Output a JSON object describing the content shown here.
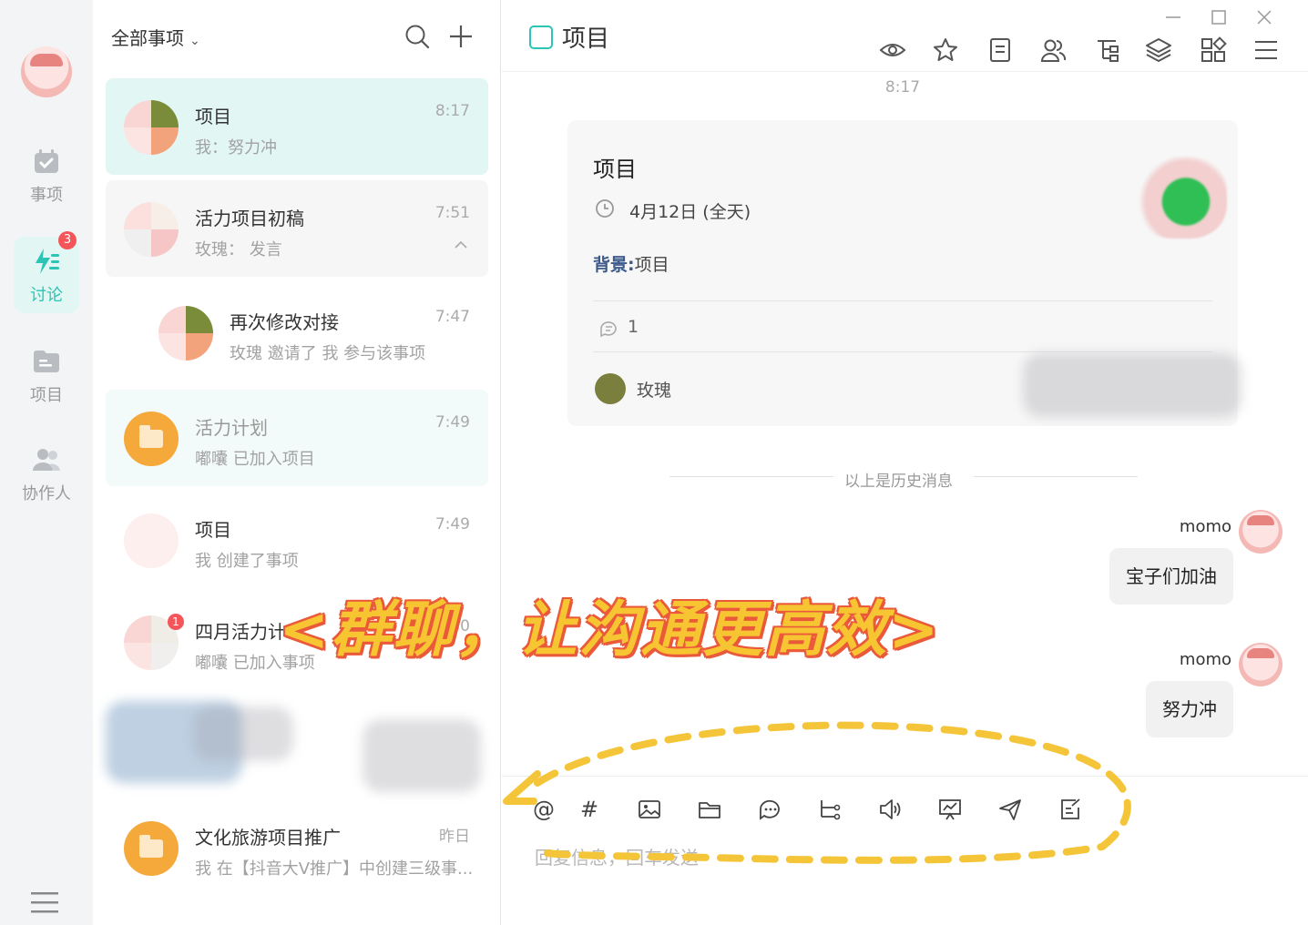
{
  "rail": {
    "nav": [
      {
        "label": "事项",
        "badge": ""
      },
      {
        "label": "讨论",
        "badge": "3"
      },
      {
        "label": "项目",
        "badge": ""
      },
      {
        "label": "协作人",
        "badge": ""
      }
    ]
  },
  "list": {
    "filter_label": "全部事项",
    "items": [
      {
        "title": "项目",
        "subtitle": "我：努力冲",
        "time": "8:17"
      },
      {
        "title": "活力项目初稿",
        "subtitle": "玫瑰： 发言",
        "time": "7:51"
      },
      {
        "title": "再次修改对接",
        "subtitle": "玫瑰 邀请了 我 参与该事项",
        "time": "7:47"
      },
      {
        "title": "活力计划",
        "subtitle": "嘟囔 已加入项目",
        "time": "7:49"
      },
      {
        "title": "项目",
        "subtitle": "我 创建了事项",
        "time": "7:49"
      },
      {
        "title": "四月活力计",
        "subtitle": "嘟囔 已加入事项",
        "time": "30"
      },
      {
        "title": "文化旅游项目推广",
        "subtitle": "我 在【抖音大V推广】中创建三级事...",
        "time": "昨日"
      }
    ],
    "item6_badge": "1"
  },
  "pane": {
    "title": "项目",
    "timestamp": "8:17",
    "card": {
      "title": "项目",
      "date": "4月12日 (全天)",
      "background_label": "背景:",
      "background_value": "项目",
      "comment_count": "1",
      "user": "玫瑰"
    },
    "history_divider": "以上是历史消息",
    "messages": [
      {
        "sender": "momo",
        "text": "宝子们加油"
      },
      {
        "sender": "momo",
        "text": "努力冲"
      }
    ],
    "input_placeholder": "回复信息，回车发送",
    "toolbar": [
      "at-icon",
      "hash-icon",
      "image-icon",
      "folder-icon",
      "chat-icon",
      "flow-icon",
      "voice-icon",
      "presentation-icon",
      "send-icon",
      "note-icon"
    ]
  },
  "overlay": {
    "slogan": "<群聊，让沟通更高效>"
  },
  "colors": {
    "accent": "#2cc4b4",
    "badge": "#f4555a",
    "slogan_fill": "#f6c531",
    "slogan_stroke": "#ea5a3a"
  }
}
